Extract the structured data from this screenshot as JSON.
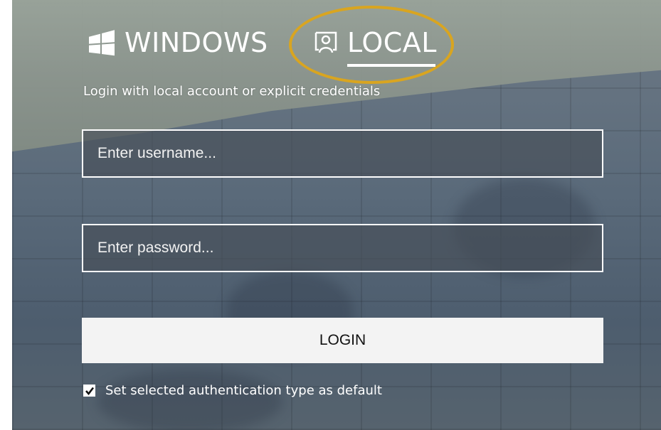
{
  "tabs": {
    "windows": {
      "label": "WINDOWS",
      "icon": "windows-logo-icon"
    },
    "local": {
      "label": "LOCAL",
      "icon": "local-account-icon",
      "selected": true
    }
  },
  "subtitle": "Login with local account or explicit credentials",
  "username": {
    "placeholder": "Enter username...",
    "value": ""
  },
  "password": {
    "placeholder": "Enter password...",
    "value": ""
  },
  "login_label": "LOGIN",
  "default_option": {
    "label": "Set selected authentication type as default",
    "checked": true
  },
  "colors": {
    "highlight_ring": "#d9a520",
    "button_bg": "#f3f3f3"
  }
}
